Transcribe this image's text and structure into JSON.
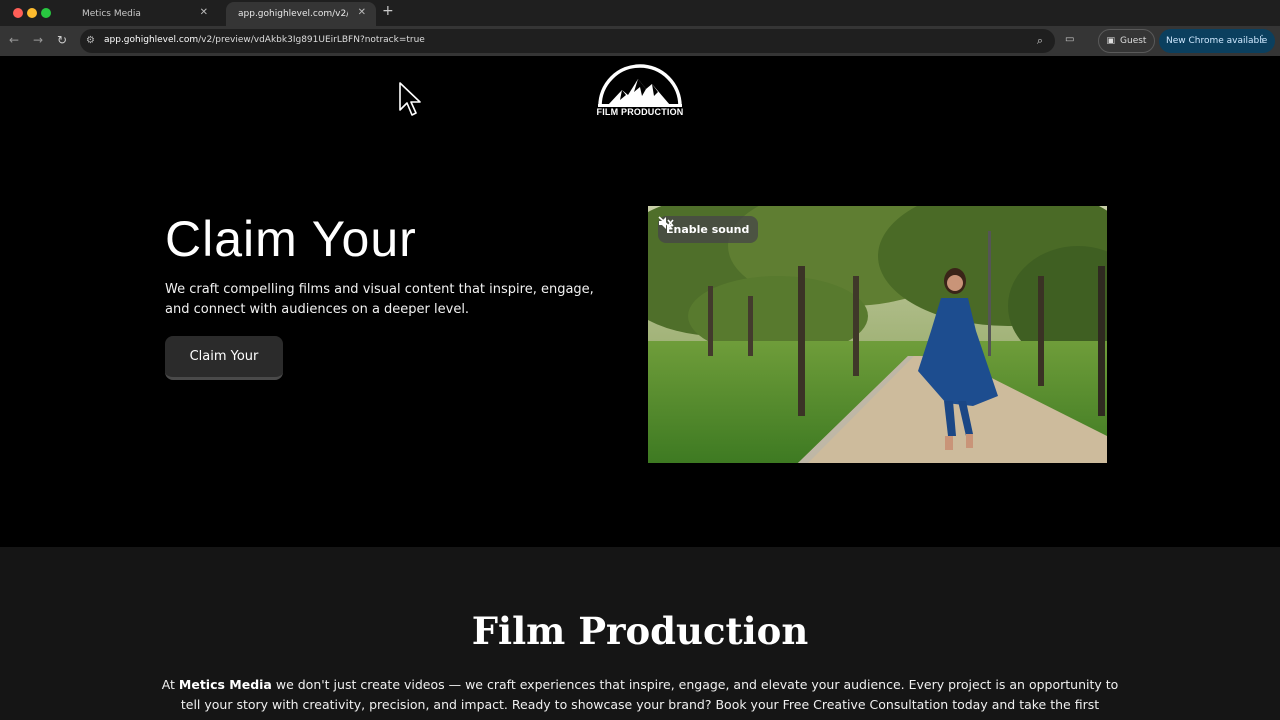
{
  "browser": {
    "tabs": [
      {
        "title": "Metics Media",
        "active": false
      },
      {
        "title": "app.gohighlevel.com/v2/preview",
        "active": true
      }
    ],
    "url_host": "app.gohighlevel.com",
    "url_path": "/v2/preview/vdAkbk3Ig891UEirLBFN?notrack=true",
    "profile_label": "Guest",
    "update_label": "New Chrome available",
    "accent_color": "#0b3f5e"
  },
  "logo": {
    "text": "FILM PRODUCTION"
  },
  "hero": {
    "title": "Claim Your",
    "description": "We craft compelling films and visual content that inspire, engage, and connect with audiences on a deeper level.",
    "button_label": "Claim Your"
  },
  "video": {
    "sound_label": "Enable sound",
    "icon": "speaker-muted-icon"
  },
  "about": {
    "title": "Film Production",
    "lead": "At",
    "brand": "Metics Media",
    "text": " we don't just create videos — we craft experiences that inspire, engage, and elevate your audience. Every project is an opportunity to tell your story with creativity, precision, and impact. Ready to showcase your brand? Book your Free Creative Consultation today and take the first"
  }
}
